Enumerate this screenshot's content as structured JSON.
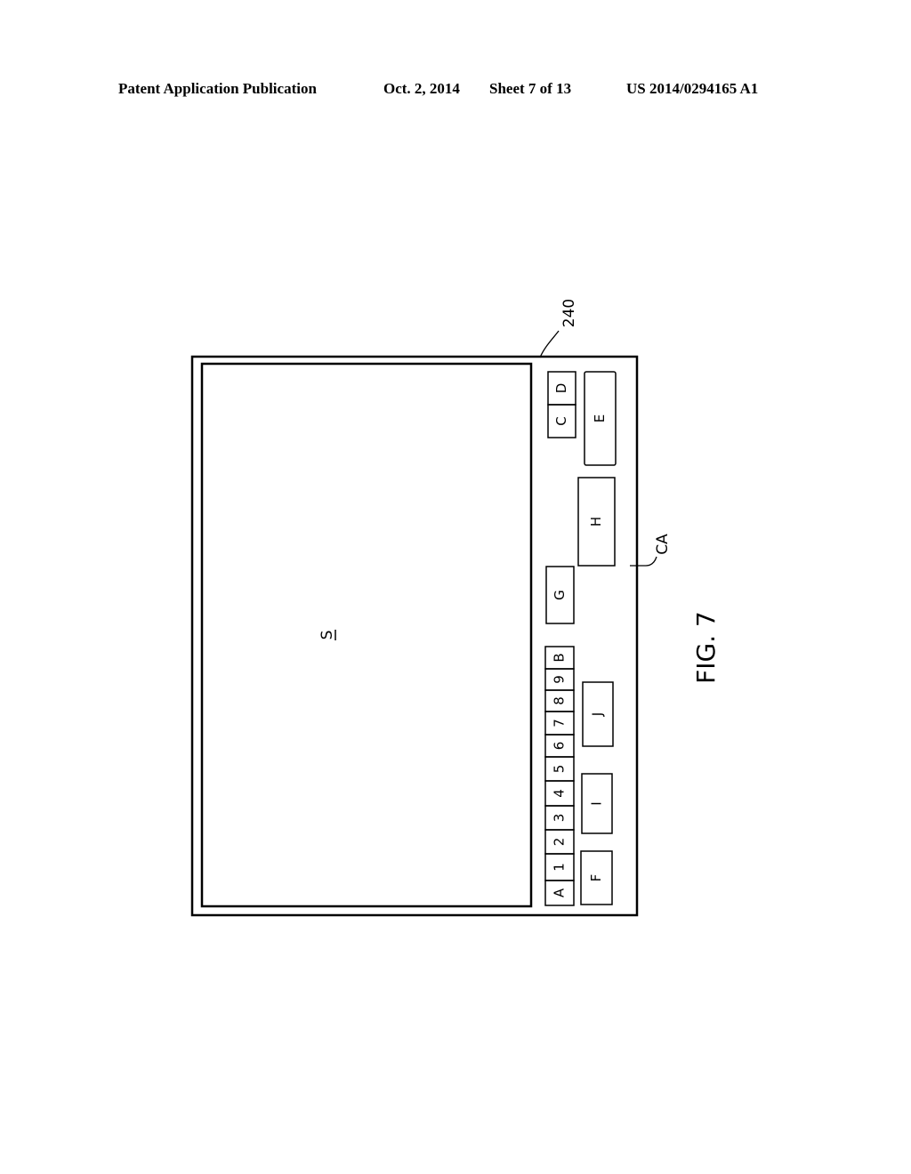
{
  "header": {
    "publication": "Patent Application Publication",
    "date": "Oct. 2, 2014",
    "sheet": "Sheet 7 of 13",
    "number": "US 2014/0294165 A1"
  },
  "figure": {
    "label": "FIG. 7",
    "device_ref": "240",
    "control_area_ref": "CA",
    "screen_label": "S",
    "keys": {
      "C": "C",
      "D": "D",
      "E": "E",
      "H": "H",
      "G": "G",
      "J": "J",
      "I": "I",
      "F": "F"
    },
    "strip_keys": [
      "B",
      "9",
      "8",
      "7",
      "6",
      "5",
      "4",
      "3",
      "2",
      "1",
      "A"
    ]
  }
}
